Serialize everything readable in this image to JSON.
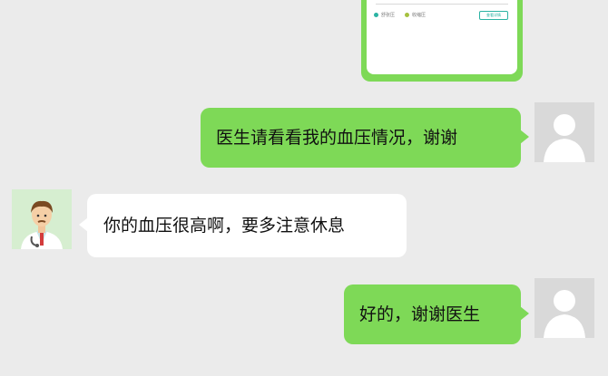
{
  "colors": {
    "background": "#ebebeb",
    "sent_bubble": "#7ed957",
    "received_bubble": "#ffffff",
    "chart_series_1": "#2bb3a3",
    "chart_series_2": "#a6c13f"
  },
  "shared_card": {
    "axis_zero": "0",
    "legend_1": "舒张压",
    "legend_2": "收缩压",
    "button_label": "查看详情"
  },
  "messages": [
    {
      "sender": "user",
      "avatar_icon": "default-user-avatar-icon",
      "text": "医生请看看我的血压情况，谢谢"
    },
    {
      "sender": "doctor",
      "avatar_icon": "doctor-avatar-icon",
      "text": "你的血压很高啊，要多注意休息"
    },
    {
      "sender": "user",
      "avatar_icon": "default-user-avatar-icon",
      "text": "好的，谢谢医生"
    }
  ]
}
